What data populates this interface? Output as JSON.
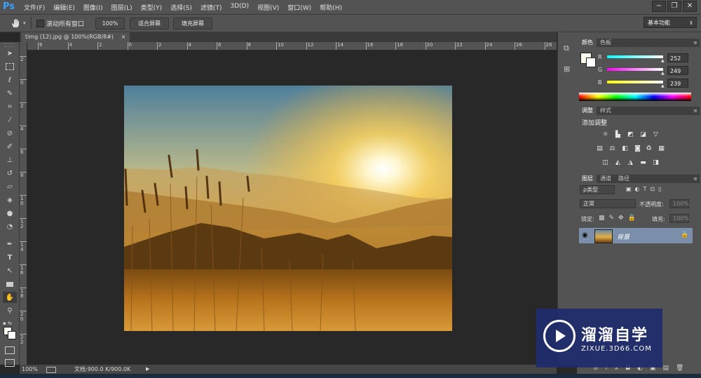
{
  "app": {
    "logo": "Ps",
    "menu": [
      "文件(F)",
      "编辑(E)",
      "图像(I)",
      "图层(L)",
      "类型(Y)",
      "选择(S)",
      "滤镜(T)",
      "3D(D)",
      "视图(V)",
      "窗口(W)",
      "帮助(H)"
    ],
    "window_controls": [
      "−",
      "❐",
      "✕"
    ]
  },
  "options": {
    "hand_icon": "hand-icon",
    "scroll_all_label": "滚动所有窗口",
    "zoom_btn": "100%",
    "fit_btn": "适合屏幕",
    "fill_btn": "填充屏幕",
    "workspace": "基本功能"
  },
  "document": {
    "tab_title": "timg (12).jpg @ 100%(RGB/8#)",
    "tab_close": "×"
  },
  "rulers": {
    "h_labels": [
      "6",
      "4",
      "2",
      "0",
      "2",
      "4",
      "6",
      "8",
      "10",
      "12",
      "14",
      "16",
      "18",
      "20",
      "22",
      "24",
      "26",
      "28"
    ],
    "v_labels": [
      "2",
      "0",
      "2",
      "4",
      "6",
      "8",
      "1 0",
      "1 2",
      "1 4",
      "1 6",
      "1 8",
      "2 0",
      "2 2"
    ]
  },
  "status": {
    "zoom": "100%",
    "doc_info": "文档:900.0 K/900.0K"
  },
  "color_panel": {
    "tabs": [
      "颜色",
      "色板"
    ],
    "channels": [
      {
        "label": "R",
        "value": "252",
        "color": "#00e5ff"
      },
      {
        "label": "G",
        "value": "249",
        "color": "#ff00ff"
      },
      {
        "label": "B",
        "value": "239",
        "color": "#ffff00"
      }
    ]
  },
  "adjust_panel": {
    "tabs": [
      "调整",
      "样式"
    ],
    "title": "添加调整"
  },
  "layers_panel": {
    "tabs": [
      "图层",
      "通道",
      "路径"
    ],
    "filter_label": "ρ类型",
    "blend_mode": "正常",
    "opacity_label": "不透明度:",
    "opacity_value": "100%",
    "lock_label": "锁定:",
    "fill_label": "填充:",
    "fill_value": "100%",
    "layer_name": "背景"
  },
  "watermark": {
    "title": "溜溜自学",
    "url": "ZIXUE.3D66.COM"
  }
}
